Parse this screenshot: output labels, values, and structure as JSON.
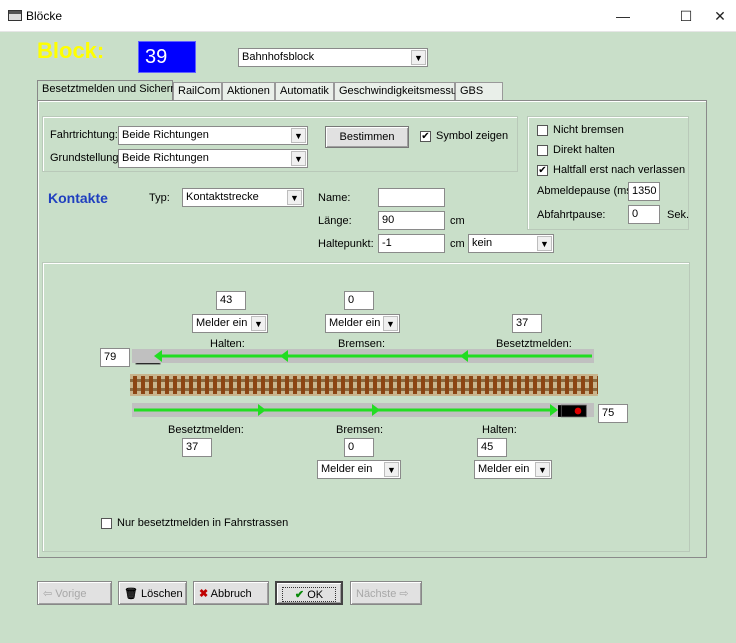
{
  "window": {
    "title": "Blöcke",
    "minimize": "—",
    "maximize": "☐",
    "close": "✕"
  },
  "header": {
    "block_label": "Block:",
    "block_number": "39",
    "block_type": "Bahnhofsblock"
  },
  "tabs": [
    "Besetztmelden und Sichern",
    "RailCom",
    "Aktionen",
    "Automatik",
    "Geschwindigkeitsmessung",
    "GBS"
  ],
  "direction": {
    "fahrtrichtung_label": "Fahrtrichtung:",
    "fahrtrichtung_value": "Beide Richtungen",
    "grundstellung_label": "Grundstellung:",
    "grundstellung_value": "Beide Richtungen",
    "bestimmen": "Bestimmen",
    "symbol_zeigen": "Symbol zeigen",
    "symbol_zeigen_checked": true
  },
  "options": {
    "nicht_bremsen": "Nicht bremsen",
    "nicht_bremsen_checked": false,
    "direkt_halten": "Direkt halten",
    "direkt_halten_checked": false,
    "haltfall": "Haltfall erst nach verlassen",
    "haltfall_checked": true,
    "abmeldepause_label": "Abmeldepause (ms):",
    "abmeldepause_value": "1350",
    "abfahrtpause_label": "Abfahrtpause:",
    "abfahrtpause_value": "0",
    "abfahrtpause_unit": "Sek."
  },
  "kontakte": {
    "title": "Kontakte",
    "typ_label": "Typ:",
    "typ_value": "Kontaktstrecke",
    "name_label": "Name:",
    "name_value": "",
    "laenge_label": "Länge:",
    "laenge_value": "90",
    "laenge_unit": "cm",
    "haltepunkt_label": "Haltepunkt:",
    "haltepunkt_value": "-1",
    "haltepunkt_unit": "cm",
    "haltepunkt_select": "kein"
  },
  "track": {
    "top": {
      "halten_label": "Halten:",
      "halten_value": "43",
      "halten_select": "Melder ein",
      "bremsen_label": "Bremsen:",
      "bremsen_value": "0",
      "bremsen_select": "Melder ein",
      "besetzt_label": "Besetztmelden:",
      "besetzt_value": "37",
      "signal_value": "79"
    },
    "bottom": {
      "besetzt_label": "Besetztmelden:",
      "besetzt_value": "37",
      "bremsen_label": "Bremsen:",
      "bremsen_value": "0",
      "bremsen_select": "Melder ein",
      "halten_label": "Halten:",
      "halten_value": "45",
      "halten_select": "Melder ein",
      "signal_value": "75"
    },
    "nur_besetzt": "Nur besetztmelden in Fahrstrassen",
    "nur_besetzt_checked": false
  },
  "footer": {
    "vorige": "Vorige",
    "loeschen": "Löschen",
    "abbruch": "Abbruch",
    "ok": "OK",
    "naechste": "Nächste"
  },
  "colors": {
    "background": "#c9dfc9",
    "block_label": "#ffff00",
    "block_number_bg": "#0000ff",
    "arrow": "#22dd22",
    "kontakte": "#1f3fbf"
  }
}
